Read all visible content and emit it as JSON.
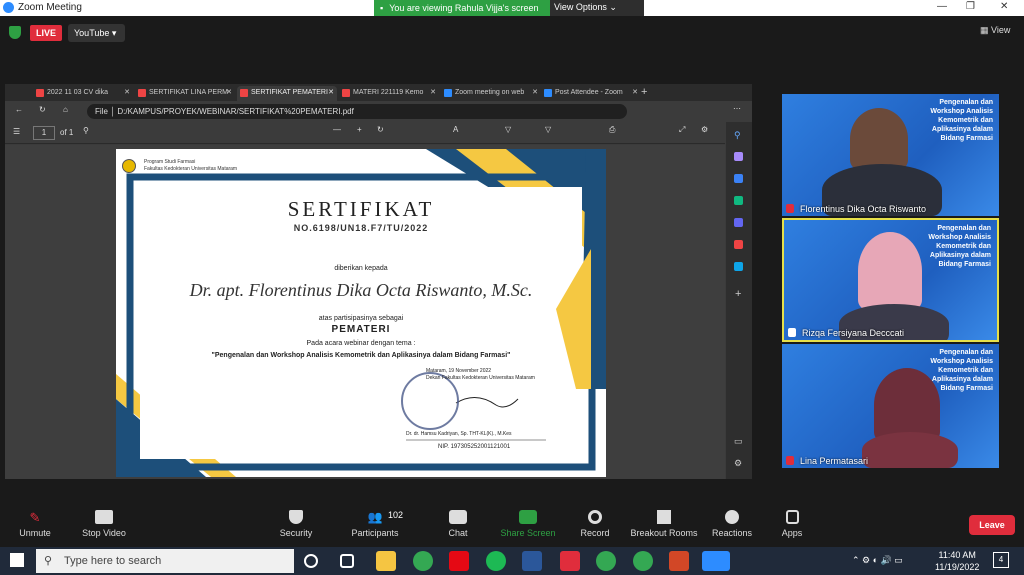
{
  "window": {
    "title": "Zoom Meeting"
  },
  "banner": {
    "viewing": "You are viewing Rahula Vijja's screen",
    "options": "View Options"
  },
  "top": {
    "live": "LIVE",
    "stream": "YouTube",
    "view": "View"
  },
  "browser": {
    "tabs": [
      {
        "label": "2022 11 03 CV dika",
        "color": "#e44"
      },
      {
        "label": "SERTIFIKAT LINA PERM",
        "color": "#e44"
      },
      {
        "label": "SERTIFIKAT PEMATERI",
        "color": "#e44"
      },
      {
        "label": "MATERI 221119 Kemo",
        "color": "#e44"
      },
      {
        "label": "Zoom meeting on web",
        "color": "#2d8cff"
      },
      {
        "label": "Post Attendee - Zoom",
        "color": "#2d8cff"
      }
    ],
    "address": "D:/KAMPUS/PROYEK/WEBINAR/SERTIFIKAT%20PEMATERI.pdf",
    "file_label": "File",
    "page": "1",
    "of": "of 1"
  },
  "certificate": {
    "prodi": "Program Studi Farmasi",
    "faculty": "Fakultas Kedokteran Universitas Mataram",
    "title": "SERTIFIKAT",
    "number": "NO.6198/UN18.F7/TU/2022",
    "given_to": "diberikan kepada",
    "name": "Dr. apt. Florentinus Dika Octa Riswanto, M.Sc.",
    "participation": "atas partisipasinya sebagai",
    "role": "PEMATERI",
    "event_intro": "Pada acara webinar dengan tema :",
    "topic": "\"Pengenalan dan Workshop Analisis Kemometrik dan Aplikasinya dalam Bidang Farmasi\"",
    "place_date": "Mataram, 19 November 2022",
    "place_faculty": "Dekan Fakultas Kedokteran Universitas Mataram",
    "signer": "Dr. dr. Hamsu Kadriyan, Sp. THT-KL(K)., M.Kes",
    "nip": "NIP. 197305252001121001"
  },
  "participants": [
    {
      "name": "Florentinus Dika Octa Riswanto",
      "bg_text": "Pengenalan dan Workshop Analisis Kemometrik dan Aplikasinya dalam Bidang Farmasi"
    },
    {
      "name": "Rizqa Fersiyana Decccati",
      "bg_text": "Pengenalan dan Workshop Analisis Kemometrik dan Aplikasinya dalam Bidang Farmasi"
    },
    {
      "name": "Lina Permatasari",
      "bg_text": "Pengenalan dan Workshop Analisis Kemometrik dan Aplikasinya dalam Bidang Farmasi"
    }
  ],
  "toolbar": {
    "unmute": "Unmute",
    "stop_video": "Stop Video",
    "security": "Security",
    "participants": "Participants",
    "participants_count": "102",
    "chat": "Chat",
    "share": "Share Screen",
    "record": "Record",
    "breakout": "Breakout Rooms",
    "reactions": "Reactions",
    "apps": "Apps",
    "leave": "Leave"
  },
  "taskbar": {
    "search": "Type here to search",
    "time": "11:40 AM",
    "date": "11/19/2022",
    "notif": "4"
  },
  "colors": {
    "live": "#e02d3c",
    "share_green": "#2ea043",
    "zoom_blue": "#2d8cff",
    "active_speaker": "#e6e04a"
  }
}
